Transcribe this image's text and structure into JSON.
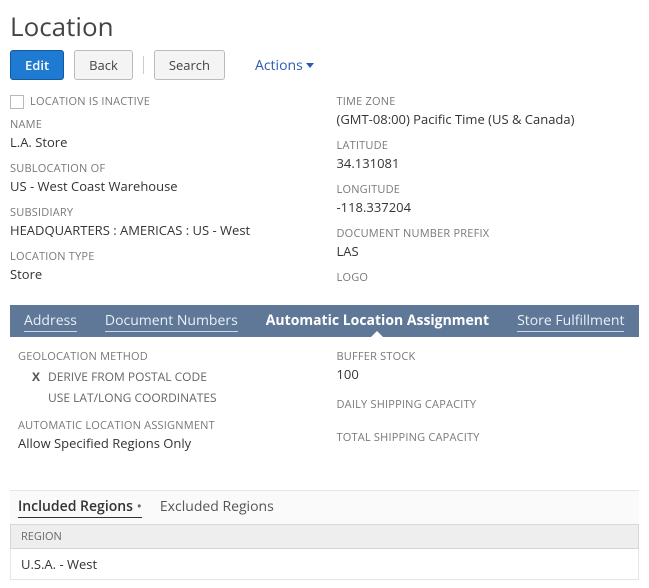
{
  "header": {
    "title": "Location",
    "edit": "Edit",
    "back": "Back",
    "search": "Search",
    "actions": "Actions"
  },
  "left": {
    "inactive_label": "LOCATION IS INACTIVE",
    "name_label": "NAME",
    "name_value": "L.A. Store",
    "subloc_label": "SUBLOCATION OF",
    "subloc_value": "US - West Coast Warehouse",
    "subsidiary_label": "SUBSIDIARY",
    "subsidiary_value": "HEADQUARTERS : AMERICAS : US - West",
    "loctype_label": "LOCATION TYPE",
    "loctype_value": "Store"
  },
  "right": {
    "tz_label": "TIME ZONE",
    "tz_value": "(GMT-08:00) Pacific Time (US & Canada)",
    "lat_label": "LATITUDE",
    "lat_value": "34.131081",
    "lon_label": "LONGITUDE",
    "lon_value": "-118.337204",
    "docprefix_label": "DOCUMENT NUMBER PREFIX",
    "docprefix_value": "LAS",
    "logo_label": "LOGO"
  },
  "tabs": {
    "address": "Address",
    "docnum": "Document Numbers",
    "ala": "Automatic Location Assignment",
    "storefulfill": "Store Fulfillment"
  },
  "ala_section": {
    "geo_label": "GEOLOCATION METHOD",
    "geo_opt1_mark": "X",
    "geo_opt1": "DERIVE FROM POSTAL CODE",
    "geo_opt2": "USE LAT/LONG COORDINATES",
    "ala_mode_label": "AUTOMATIC LOCATION ASSIGNMENT",
    "ala_mode_value": "Allow Specified Regions Only",
    "buffer_label": "BUFFER STOCK",
    "buffer_value": "100",
    "daily_label": "DAILY SHIPPING CAPACITY",
    "total_label": "TOTAL SHIPPING CAPACITY"
  },
  "subtabs": {
    "included": "Included Regions",
    "excluded": "Excluded Regions"
  },
  "region_table": {
    "header": "REGION",
    "row0": "U.S.A. - West"
  }
}
